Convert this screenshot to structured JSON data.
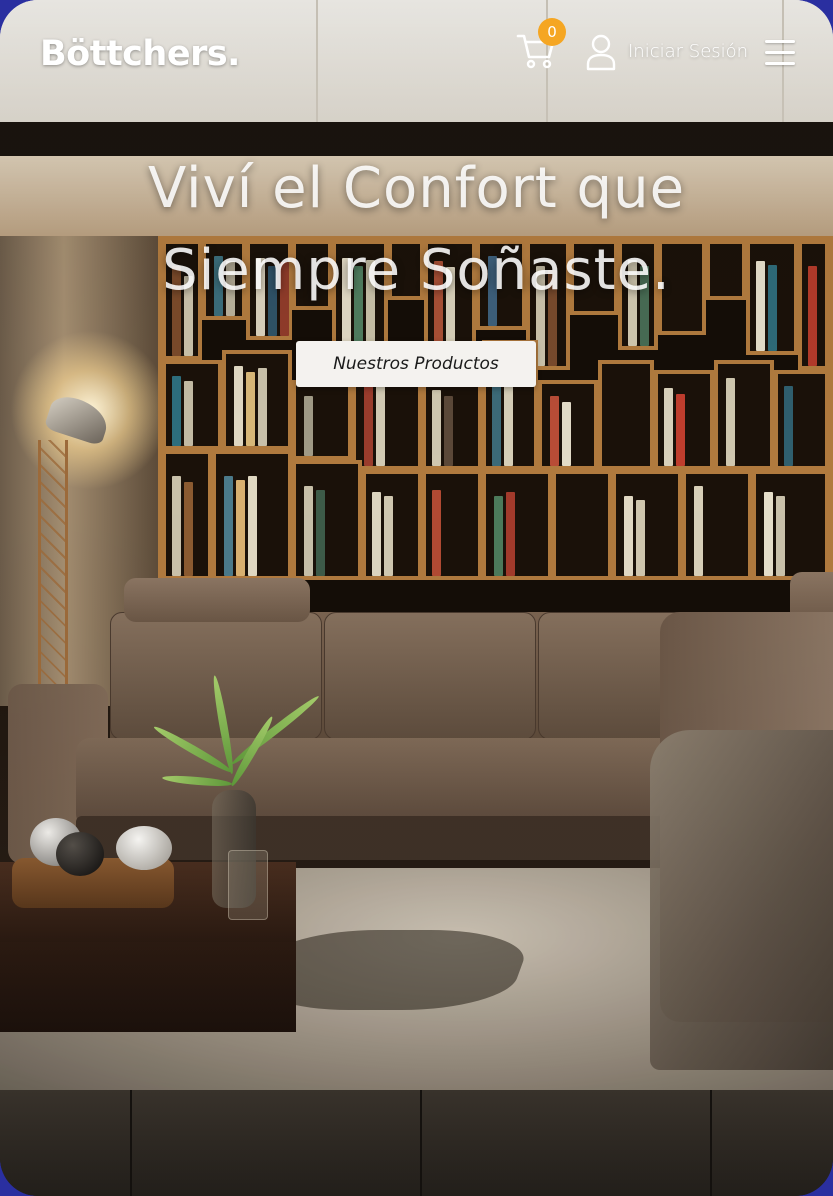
{
  "header": {
    "logo": "Böttchers.",
    "cart_count": "0",
    "login_label": "Iniciar Sesión"
  },
  "hero": {
    "title_line1": "Viví el Confort que",
    "title_line2": "Siempre Soñaste.",
    "cta_label": "Nuestros Productos"
  },
  "icons": [
    "cart-icon",
    "user-icon",
    "hamburger-menu-icon"
  ],
  "colors": {
    "badge": "#f5a623",
    "button_bg": "#f4f2ef",
    "text": "#ffffff"
  }
}
